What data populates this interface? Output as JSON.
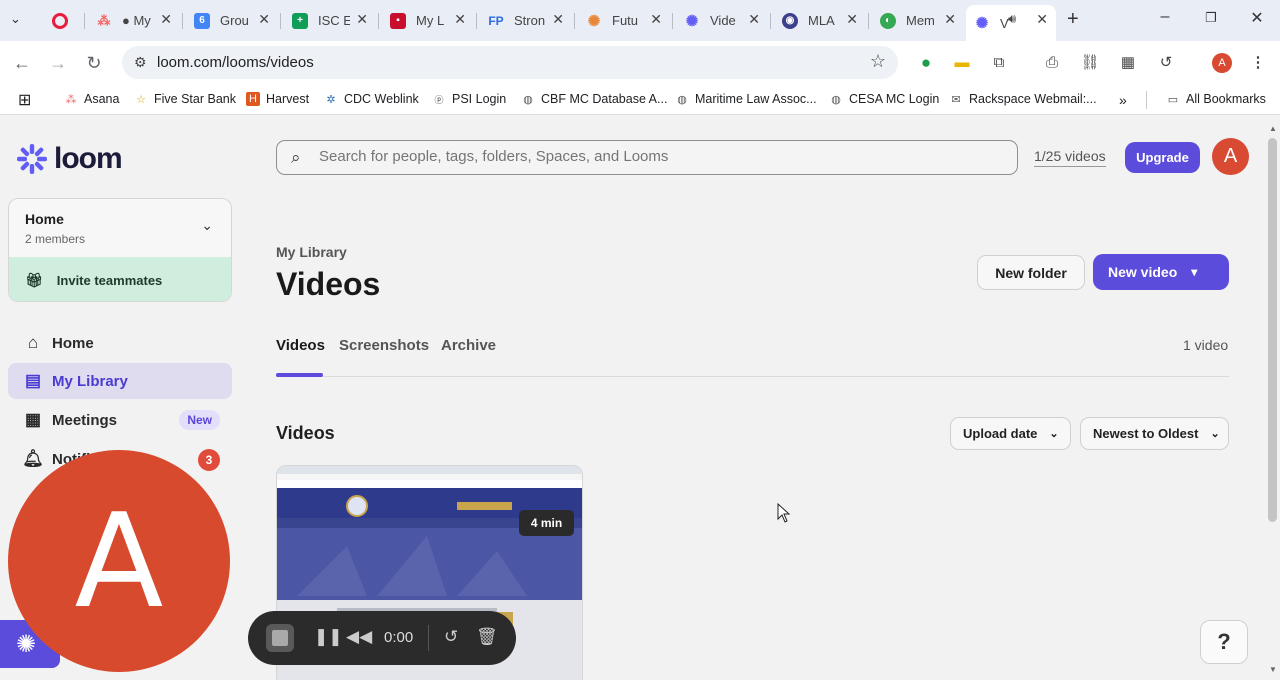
{
  "browser": {
    "tabs": [
      {
        "label": "",
        "icon": "record-icon",
        "color": "#e81c3c"
      },
      {
        "label": "● My",
        "icon": "asana-icon",
        "color": "#f06a6a"
      },
      {
        "label": "Grou",
        "icon": "gmail-icon",
        "color": "#4285f4"
      },
      {
        "label": "ISC E",
        "icon": "sheets-icon",
        "color": "#0f9d58"
      },
      {
        "label": "My L",
        "icon": "harvest-icon",
        "color": "#c8102e"
      },
      {
        "label": "Stron",
        "icon": "fp-icon",
        "color": "#2d6cdf"
      },
      {
        "label": "Futu",
        "icon": "sunburst-icon",
        "color": "#e8873a"
      },
      {
        "label": "Vide",
        "icon": "loom-icon",
        "color": "#625df5"
      },
      {
        "label": "MLA",
        "icon": "mla-icon",
        "color": "#3b3f8c"
      },
      {
        "label": "Mem",
        "icon": "globe-icon",
        "color": "#34a853"
      },
      {
        "label": "V",
        "icon": "loom-icon",
        "color": "#625df5"
      }
    ],
    "url": "loom.com/looms/videos",
    "bookmarks": [
      {
        "label": "Asana",
        "icon": "asana-icon"
      },
      {
        "label": "Five Star Bank",
        "icon": "star-icon"
      },
      {
        "label": "Harvest",
        "icon": "harvest-icon"
      },
      {
        "label": "CDC Weblink",
        "icon": "gear-icon"
      },
      {
        "label": "PSI Login",
        "icon": "psi-icon"
      },
      {
        "label": "CBF MC Database A...",
        "icon": "globe-icon"
      },
      {
        "label": "Maritime Law Assoc...",
        "icon": "globe-icon"
      },
      {
        "label": "CESA MC Login",
        "icon": "globe-icon"
      },
      {
        "label": "Rackspace Webmail:...",
        "icon": "mail-icon"
      }
    ],
    "all_bookmarks": "All Bookmarks",
    "profile_initial": "A"
  },
  "sidebar": {
    "logo_text": "loom",
    "workspace": {
      "name": "Home",
      "members": "2 members"
    },
    "invite": "Invite teammates",
    "nav": [
      {
        "label": "Home",
        "icon": "home-icon"
      },
      {
        "label": "My Library",
        "icon": "library-icon",
        "active": true
      },
      {
        "label": "Meetings",
        "icon": "calendar-icon",
        "badge": "New"
      },
      {
        "label": "Notifi",
        "icon": "bell-icon",
        "count": "3"
      }
    ]
  },
  "main": {
    "search_placeholder": "Search for people, tags, folders, Spaces, and Looms",
    "video_count": "1/25 videos",
    "upgrade": "Upgrade",
    "avatar_initial": "A",
    "breadcrumb": "My Library",
    "title": "Videos",
    "new_folder": "New folder",
    "new_video": "New video",
    "tabs": [
      "Videos",
      "Screenshots",
      "Archive"
    ],
    "tab_count": "1 video",
    "section_title": "Videos",
    "sort_by": "Upload date",
    "sort_order": "Newest to Oldest",
    "duration": "4 min",
    "help": "?"
  },
  "recorder": {
    "avatar_initial": "A",
    "time": "0:00"
  },
  "colors": {
    "accent": "#5b4cdb",
    "avatar": "#d84a2e",
    "invite_bg": "#cfeedd"
  }
}
